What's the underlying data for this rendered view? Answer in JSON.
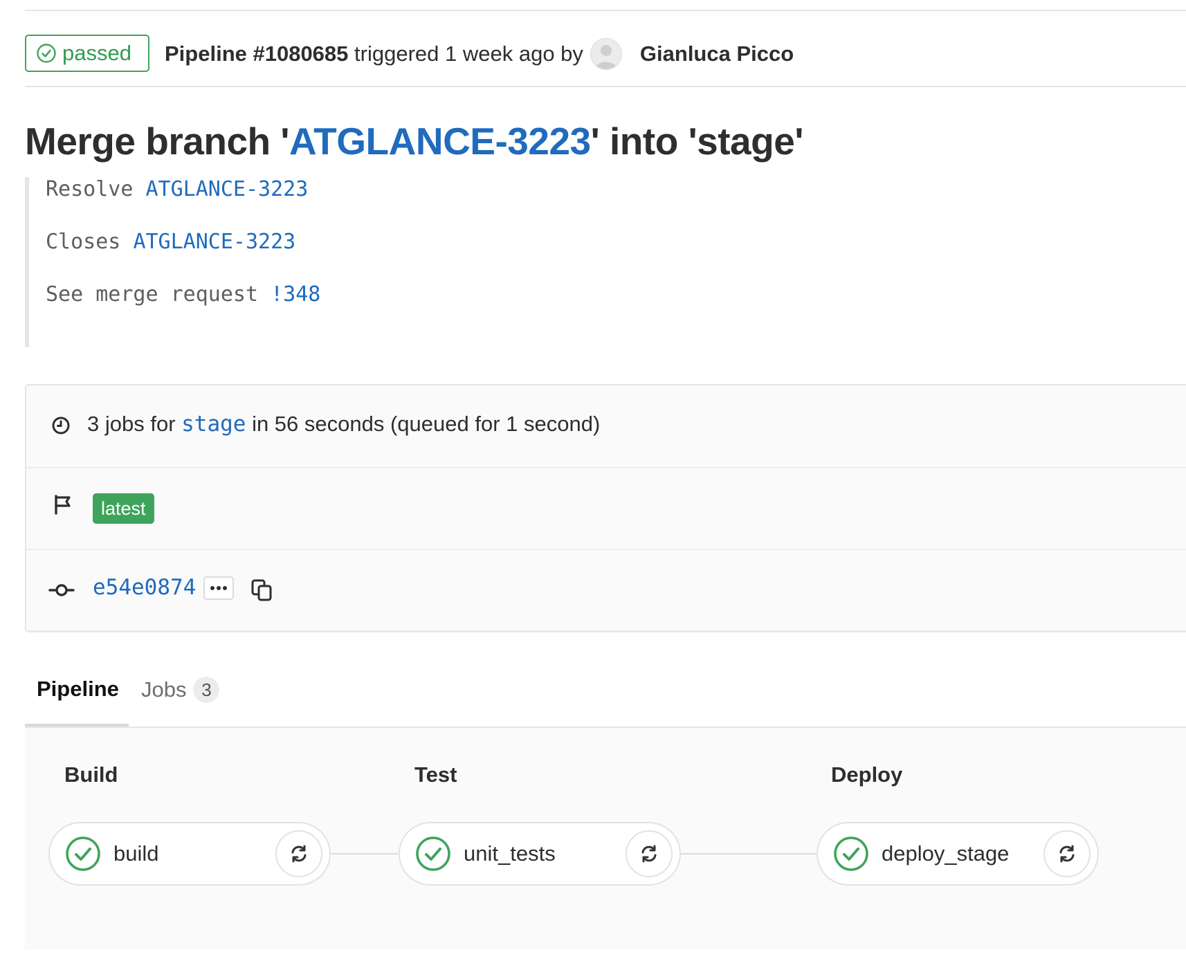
{
  "pipeline_header": {
    "status_label": "passed",
    "pipeline_id": "Pipeline #1080685",
    "triggered_text": "triggered 1 week ago by",
    "author": "Gianluca Picco"
  },
  "commit": {
    "title_prefix": "Merge branch '",
    "title_branch": "ATGLANCE-3223",
    "title_suffix": "' into 'stage'",
    "body": [
      {
        "text": "Resolve ",
        "link": "ATGLANCE-3223"
      },
      {
        "text": "Closes ",
        "link": "ATGLANCE-3223"
      },
      {
        "text": "See merge request ",
        "link": "!348"
      }
    ]
  },
  "info": {
    "jobs_prefix": "3 jobs for ",
    "jobs_branch": "stage",
    "jobs_suffix": " in 56 seconds (queued for 1 second)",
    "tag": "latest",
    "sha": "e54e0874"
  },
  "tabs": {
    "pipeline": "Pipeline",
    "jobs": "Jobs",
    "jobs_count": "3"
  },
  "stages": [
    {
      "name": "Build",
      "job": "build"
    },
    {
      "name": "Test",
      "job": "unit_tests"
    },
    {
      "name": "Deploy",
      "job": "deploy_stage"
    }
  ],
  "colors": {
    "success": "#3fa45b",
    "link": "#1f6bbd"
  }
}
